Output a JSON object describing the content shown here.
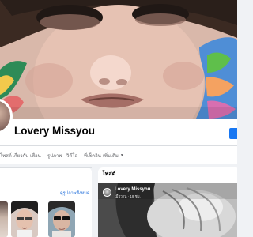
{
  "profile": {
    "name": "Lovery Missyou"
  },
  "tabs": [
    {
      "label": "โพสต์"
    },
    {
      "label": "เกี่ยวกับ"
    },
    {
      "label": "เพื่อน"
    },
    {
      "label": "รูปภาพ"
    },
    {
      "label": "วิดีโอ"
    },
    {
      "label": "ที่เช็คอิน"
    },
    {
      "label": "เพิ่มเติม"
    }
  ],
  "friends_card": {
    "see_all_label": "ดูรูปภาพทั้งหมด"
  },
  "post_card": {
    "title": "โพสต์",
    "author": "Lovery Missyou",
    "meta": "เมื่อวาน · 19 ชม."
  },
  "colors": {
    "brand_blue": "#1877f2",
    "link_blue": "#216fdb",
    "page_bg": "#f0f2f5"
  }
}
